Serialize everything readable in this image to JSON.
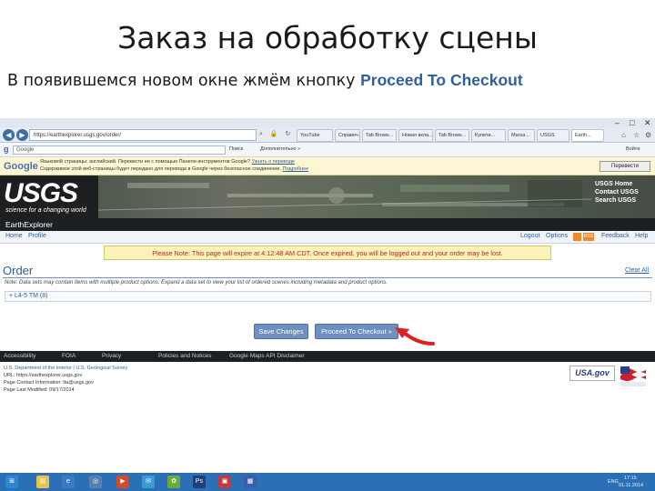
{
  "slide": {
    "title": "Заказ на обработку сцены",
    "caption_prefix": "В появившемся новом окне жмём кнопку",
    "caption_button": "Proceed To Checkout"
  },
  "browser": {
    "address": "https://earthexplorer.usgs.gov/order/",
    "tabs": [
      "YouTube",
      "Справоч...",
      "Tab Brows...",
      "Новая вкла...",
      "Tab Brows...",
      "Купити...",
      "Магаз...",
      "USGS",
      "Earth..."
    ],
    "google_search_placeholder": "Google",
    "google_items": [
      "Поиск",
      "Дополнительно »"
    ],
    "login": "Войти"
  },
  "translate_bar": {
    "logo": "Google",
    "line1": "Языковой страницы: английский. Перевести ее с помощью Панели инструментов Google?",
    "line1_link": "Узнать о переводе",
    "line2": "Содержимое этой веб-страницы будет передано для перевода в Google через безопасное соединение.",
    "line2_link": "Подробнее",
    "button": "Перевести"
  },
  "usgs": {
    "logo": "USGS",
    "tagline": "science for a changing world",
    "links": [
      "USGS Home",
      "Contact USGS",
      "Search USGS"
    ],
    "app_name": "EarthExplorer"
  },
  "menu": {
    "left": [
      "Home",
      "Profile"
    ],
    "right": [
      "Logout",
      "Options",
      "Feedback",
      "Help"
    ],
    "rss": "RSS"
  },
  "notice": "Please Note: This page will expire at 4:12:48 AM CDT. Once expired, you will be logged out and your order may be lost.",
  "order": {
    "heading": "Order",
    "clear_all": "Clear All",
    "note": "Note: Data sets may contain items with multiple product options. Expand a data set to view your list of ordered scenes including metadata and product options.",
    "dataset": "+ L4-5 TM (8)",
    "save_button": "Save Changes",
    "proceed_button": "Proceed To Checkout »"
  },
  "footer": {
    "nav": [
      "Accessibility",
      "FOIA",
      "Privacy",
      "Policies and Notices",
      "Google Maps API Disclaimer"
    ],
    "info": [
      "U.S. Department of the Interior | U.S. Geological Survey",
      "URL: https://earthexplorer.usgs.gov",
      "Page Contact Information: lta@usgs.gov",
      "Page Last Modified: 09/17/2014"
    ],
    "usagov": "USA.gov"
  },
  "taskbar": {
    "lang": "ENG",
    "time": "17:15",
    "date": "01.11.2014"
  },
  "colors": {
    "accent": "#2f5f9e",
    "button": "#6f8fc1",
    "notice_text": "#b52a1e",
    "taskbar": "#2b6fb7",
    "arrow": "#e02020"
  }
}
